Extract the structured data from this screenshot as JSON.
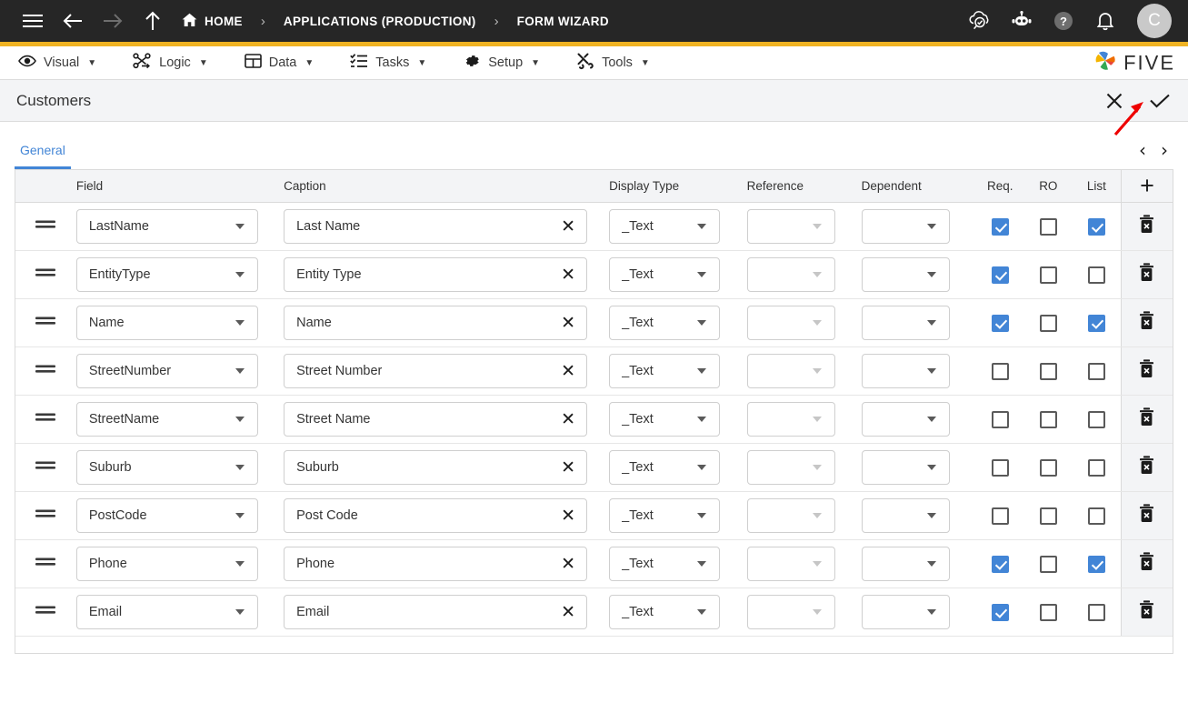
{
  "topbar": {
    "menu_icon": "hamburger-icon",
    "back_icon": "arrow-left-icon",
    "forward_icon": "arrow-right-icon",
    "up_icon": "arrow-up-icon",
    "breadcrumbs": [
      {
        "label": "HOME",
        "icon": "home-icon"
      },
      {
        "label": "APPLICATIONS (PRODUCTION)",
        "icon": ""
      },
      {
        "label": "FORM WIZARD",
        "icon": ""
      }
    ],
    "separator": "›",
    "icons": [
      {
        "name": "cloud-check-search-icon"
      },
      {
        "name": "chatbot-icon"
      },
      {
        "name": "help-icon"
      },
      {
        "name": "notifications-bell-icon"
      }
    ],
    "avatar_initial": "C"
  },
  "menubar": {
    "items": [
      {
        "label": "Visual",
        "icon": "eye-icon",
        "caret": "▼"
      },
      {
        "label": "Logic",
        "icon": "logic-nodes-icon",
        "caret": "▼"
      },
      {
        "label": "Data",
        "icon": "table-grid-icon",
        "caret": "▼"
      },
      {
        "label": "Tasks",
        "icon": "checklist-icon",
        "caret": "▼"
      },
      {
        "label": "Setup",
        "icon": "gear-icon",
        "caret": "▼"
      },
      {
        "label": "Tools",
        "icon": "tools-icon",
        "caret": "▼"
      }
    ],
    "brand": "FIVE"
  },
  "page": {
    "title": "Customers",
    "close_label": "✕",
    "save_label": "✓",
    "tabs": [
      {
        "label": "General",
        "active": true
      }
    ],
    "nav_prev": "‹",
    "nav_next": "›"
  },
  "grid": {
    "columns": [
      {
        "key": "handle",
        "label": ""
      },
      {
        "key": "field",
        "label": "Field"
      },
      {
        "key": "caption",
        "label": "Caption"
      },
      {
        "key": "display",
        "label": "Display Type"
      },
      {
        "key": "reference",
        "label": "Reference"
      },
      {
        "key": "dependent",
        "label": "Dependent"
      },
      {
        "key": "req",
        "label": "Req."
      },
      {
        "key": "ro",
        "label": "RO"
      },
      {
        "key": "list",
        "label": "List"
      },
      {
        "key": "add",
        "label": "+"
      }
    ],
    "rows": [
      {
        "field": "LastName",
        "caption": "Last Name",
        "display": "_Text",
        "reference": "",
        "dependent": "",
        "req": true,
        "ro": false,
        "list": true
      },
      {
        "field": "EntityType",
        "caption": "Entity Type",
        "display": "_Text",
        "reference": "",
        "dependent": "",
        "req": true,
        "ro": false,
        "list": false
      },
      {
        "field": "Name",
        "caption": "Name",
        "display": "_Text",
        "reference": "",
        "dependent": "",
        "req": true,
        "ro": false,
        "list": true
      },
      {
        "field": "StreetNumber",
        "caption": "Street Number",
        "display": "_Text",
        "reference": "",
        "dependent": "",
        "req": false,
        "ro": false,
        "list": false
      },
      {
        "field": "StreetName",
        "caption": "Street Name",
        "display": "_Text",
        "reference": "",
        "dependent": "",
        "req": false,
        "ro": false,
        "list": false
      },
      {
        "field": "Suburb",
        "caption": "Suburb",
        "display": "_Text",
        "reference": "",
        "dependent": "",
        "req": false,
        "ro": false,
        "list": false
      },
      {
        "field": "PostCode",
        "caption": "Post Code",
        "display": "_Text",
        "reference": "",
        "dependent": "",
        "req": false,
        "ro": false,
        "list": false
      },
      {
        "field": "Phone",
        "caption": "Phone",
        "display": "_Text",
        "reference": "",
        "dependent": "",
        "req": true,
        "ro": false,
        "list": true
      },
      {
        "field": "Email",
        "caption": "Email",
        "display": "_Text",
        "reference": "",
        "dependent": "",
        "req": true,
        "ro": false,
        "list": false
      }
    ],
    "clear_label": "✕",
    "delete_icon": "trash-delete-icon"
  },
  "annotation": {
    "type": "red-arrow",
    "points_to": "save-check-button",
    "color": "#ee0000"
  },
  "colors": {
    "topbar_bg": "#262626",
    "accent_yellow": "#f0b323",
    "tab_blue": "#4285d6",
    "checkbox_blue": "#4285d6",
    "header_grey": "#f3f4f6"
  }
}
